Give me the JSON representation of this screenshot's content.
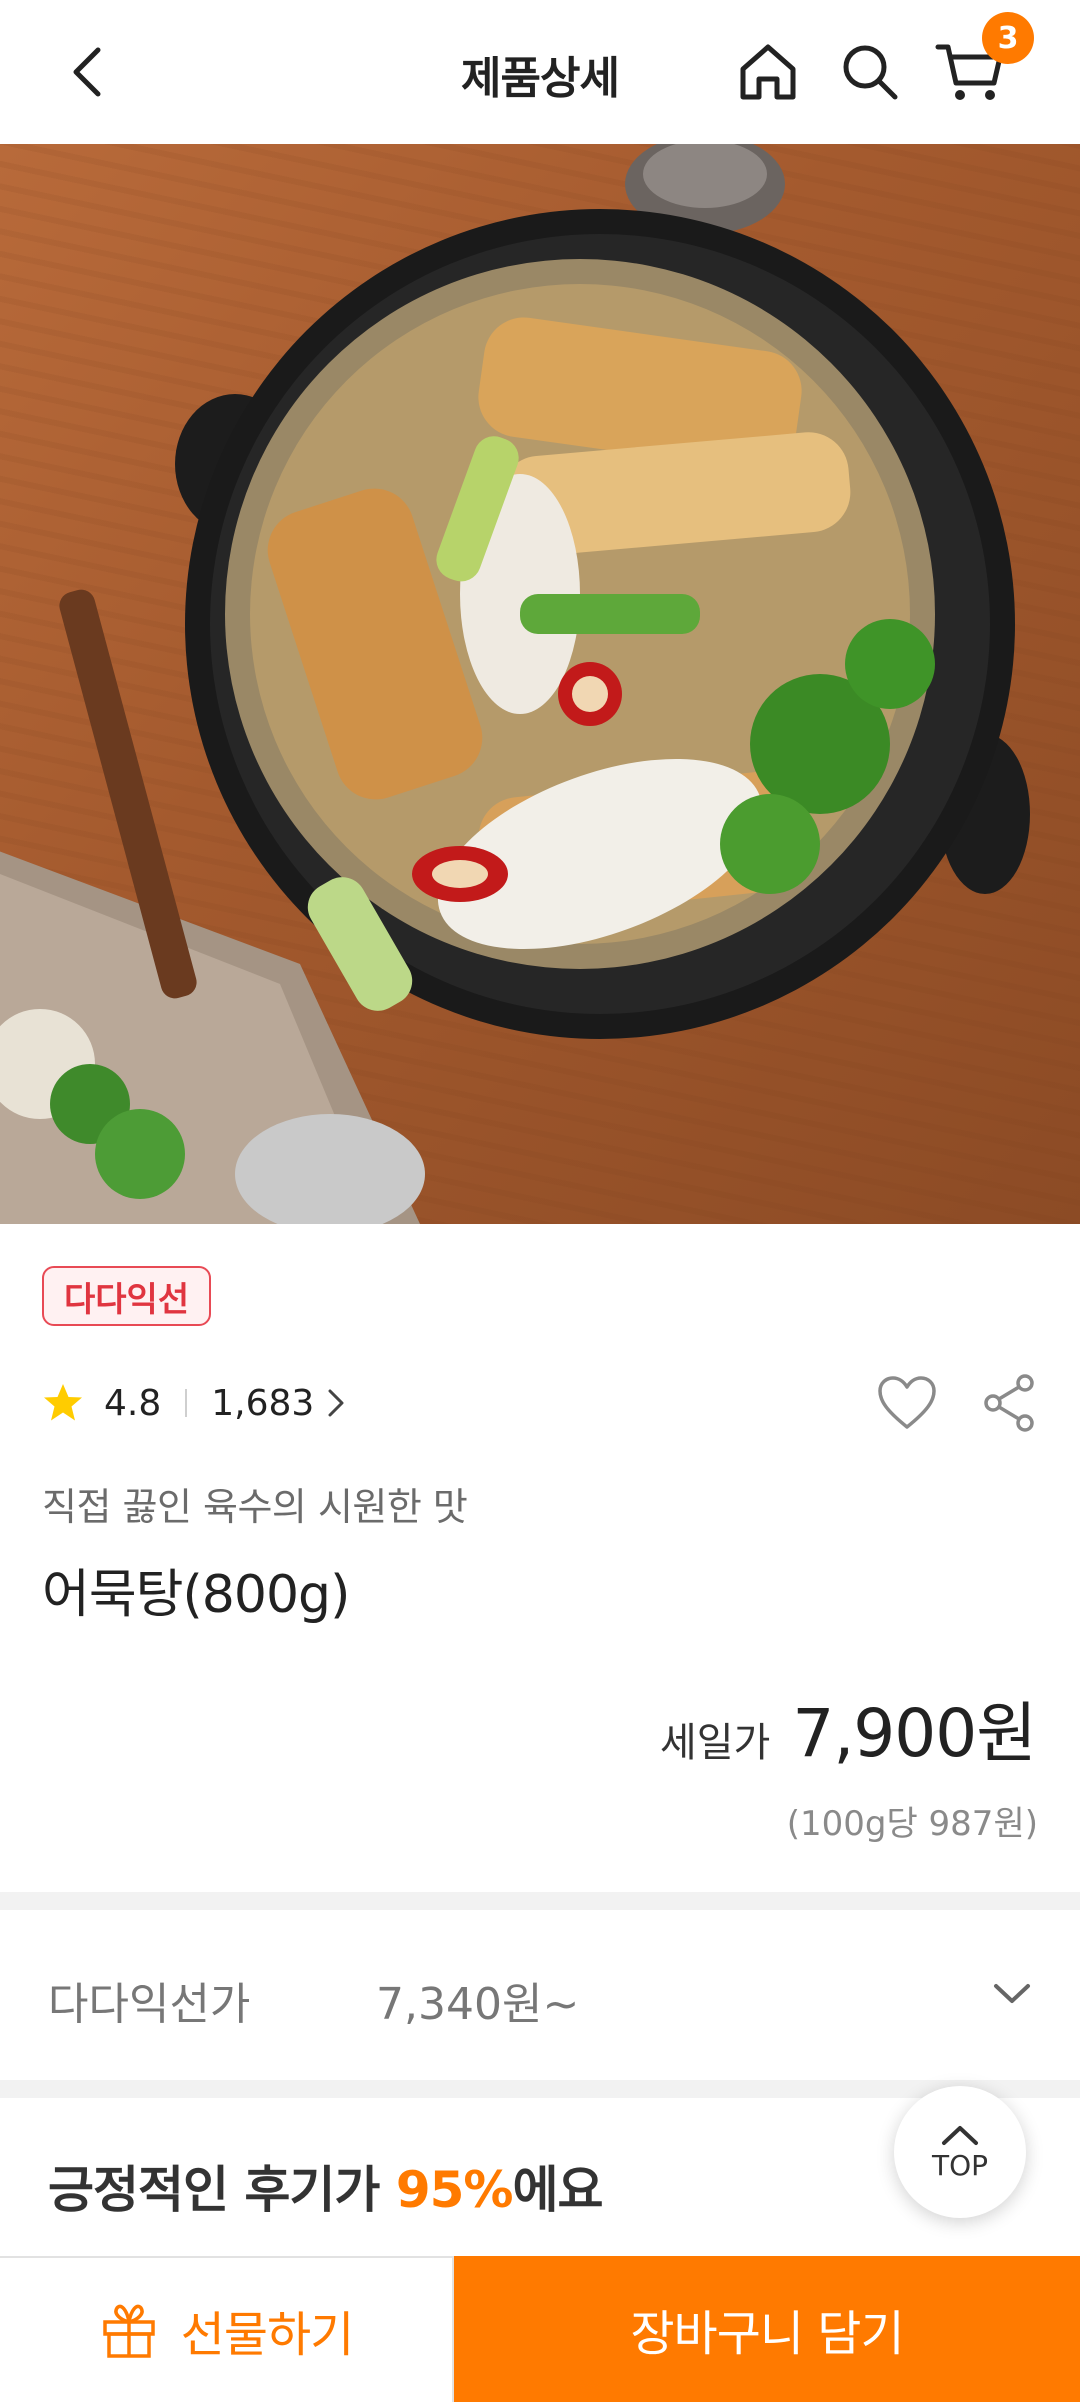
{
  "header": {
    "title": "제품상세",
    "cart_count": "3"
  },
  "product": {
    "image_alt": "어묵탕 (fish cake soup) in black pot on wooden table",
    "brand_badge": "다다익선",
    "rating": "4.8",
    "review_count": "1,683",
    "subtitle": "직접 끓인 육수의 시원한 맛",
    "name": "어묵탕(800g)",
    "price_label": "세일가",
    "price": "7,900원",
    "unit_price": "(100g당 987원)"
  },
  "member_price": {
    "label": "다다익선가",
    "value": "7,340원~"
  },
  "review_summary": {
    "prefix": "긍정적인 후기가 ",
    "percent": "95%",
    "suffix": "에요"
  },
  "top_button": {
    "label": "TOP"
  },
  "bottom_bar": {
    "gift_label": "선물하기",
    "cart_label": "장바구니 담기"
  },
  "colors": {
    "accent": "#ff7a00",
    "badge_red": "#e03540",
    "star": "#ffcc00"
  },
  "icons": [
    "back-arrow-icon",
    "home-icon",
    "search-icon",
    "cart-icon",
    "star-icon",
    "chevron-right-icon",
    "heart-icon",
    "share-icon",
    "chevron-down-icon",
    "chevron-up-icon",
    "gift-icon"
  ]
}
